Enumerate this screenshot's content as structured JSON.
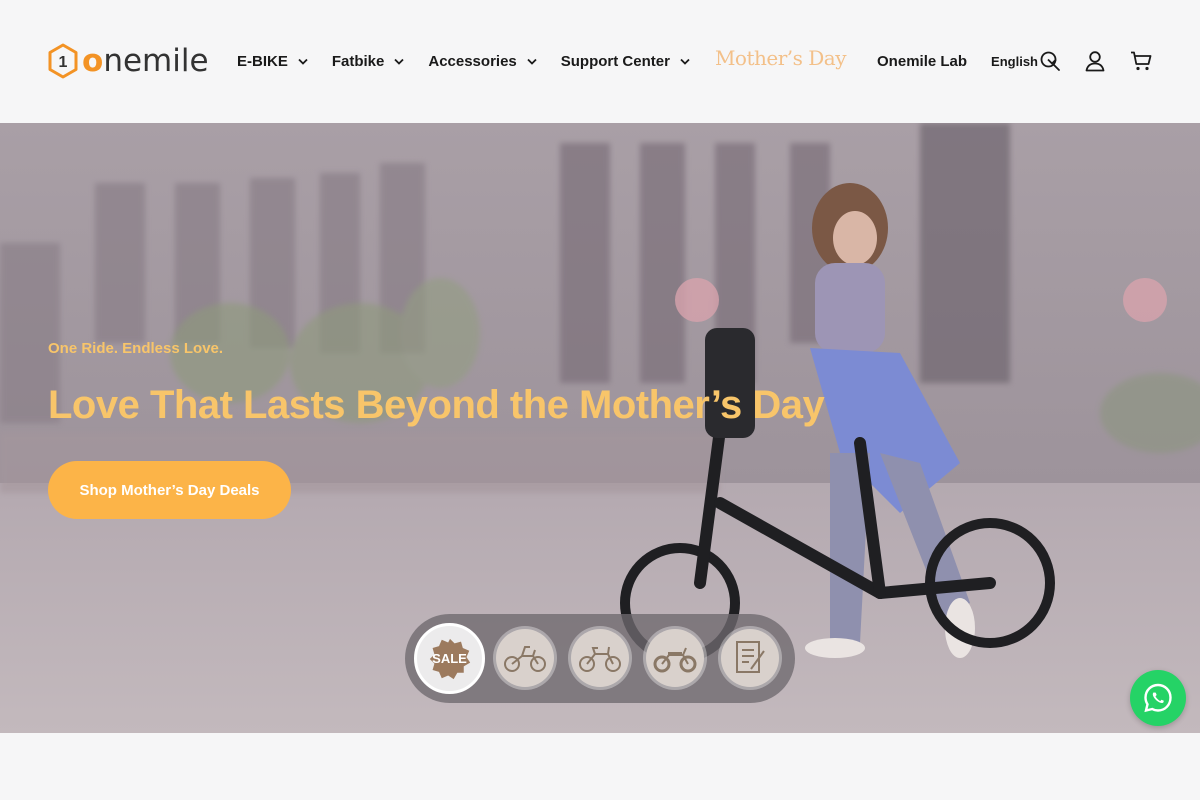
{
  "brand": {
    "logo_number": "1",
    "name_first_letter": "o",
    "name_rest": "nemile"
  },
  "nav": {
    "items": [
      {
        "label": "E-BIKE"
      },
      {
        "label": "Fatbike"
      },
      {
        "label": "Accessories"
      },
      {
        "label": "Support Center"
      }
    ],
    "special_label": "Mother’s Day",
    "lab_label": "Onemile Lab",
    "language": "English"
  },
  "icons": {
    "search": "search-icon",
    "account": "account-icon",
    "cart": "cart-icon",
    "whatsapp": "whatsapp-icon"
  },
  "hero": {
    "tagline": "One Ride. Endless Love.",
    "title": "Love That Lasts Beyond the Mother’s Day",
    "cta_label": "Shop Mother’s Day Deals",
    "slides": [
      {
        "label": "SALE",
        "icon": "sale-badge-icon",
        "active": true
      },
      {
        "label": "",
        "icon": "folding-bike-icon",
        "active": false
      },
      {
        "label": "",
        "icon": "city-bike-icon",
        "active": false
      },
      {
        "label": "",
        "icon": "fat-bike-icon",
        "active": false
      },
      {
        "label": "",
        "icon": "document-icon",
        "active": false
      }
    ]
  },
  "colors": {
    "accent": "#f39325",
    "hero_text": "#f8c56a",
    "cta": "#fcb448",
    "whatsapp": "#25d366"
  }
}
